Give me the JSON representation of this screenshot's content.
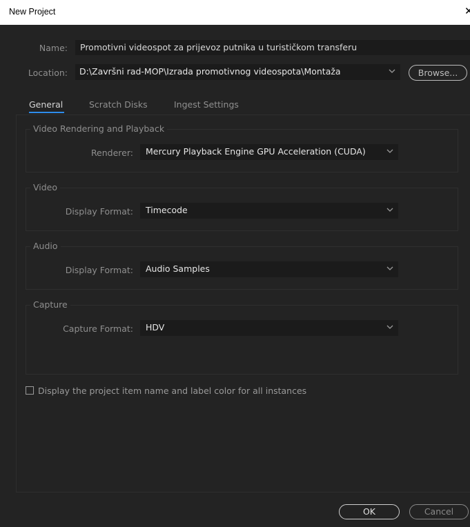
{
  "window": {
    "title": "New Project",
    "close_icon": "close-icon"
  },
  "project": {
    "name_label": "Name:",
    "name_value": "Promotivni videospot za prijevoz putnika u turističkom transferu",
    "location_label": "Location:",
    "location_value": "D:\\Završni rad-MOP\\Izrada promotivnog videospota\\Montaža",
    "browse_label": "Browse..."
  },
  "tabs": [
    {
      "label": "General",
      "active": true
    },
    {
      "label": "Scratch Disks",
      "active": false
    },
    {
      "label": "Ingest Settings",
      "active": false
    }
  ],
  "groups": {
    "rendering": {
      "title": "Video Rendering and Playback",
      "renderer_label": "Renderer:",
      "renderer_value": "Mercury Playback Engine GPU Acceleration (CUDA)"
    },
    "video": {
      "title": "Video",
      "display_format_label": "Display Format:",
      "display_format_value": "Timecode"
    },
    "audio": {
      "title": "Audio",
      "display_format_label": "Display Format:",
      "display_format_value": "Audio Samples"
    },
    "capture": {
      "title": "Capture",
      "capture_format_label": "Capture Format:",
      "capture_format_value": "HDV"
    }
  },
  "options": {
    "display_name_label": "Display the project item name and label color for all instances",
    "display_name_checked": false
  },
  "footer": {
    "ok_label": "OK",
    "cancel_label": "Cancel"
  },
  "colors": {
    "background": "#232323",
    "accent": "#2d8ceb"
  }
}
